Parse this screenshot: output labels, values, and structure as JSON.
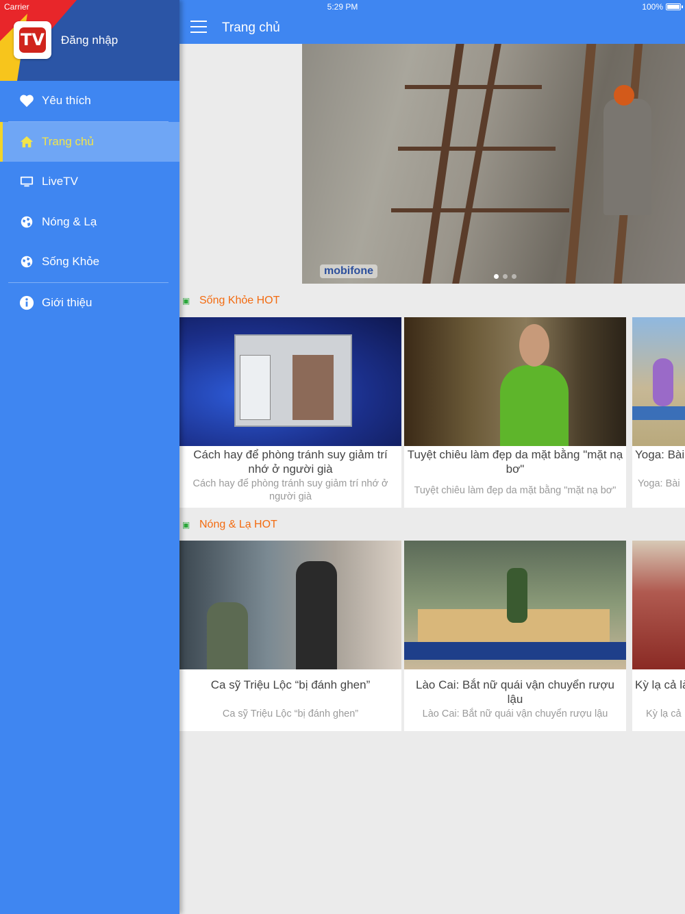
{
  "status_bar": {
    "carrier": "Carrier",
    "time": "5:29 PM",
    "battery": "100%"
  },
  "header": {
    "title": "Trang chủ"
  },
  "hero": {
    "logo_text": "mobifone",
    "slide_count": 3,
    "active_slide": 1
  },
  "sections": [
    {
      "title": "Sống Khỏe HOT",
      "cards": [
        {
          "title": "Cách hay để phòng tránh suy giảm trí nhớ ở người già",
          "desc": "Cách hay để phòng tránh suy giảm trí nhớ ở người già"
        },
        {
          "title": "Tuyệt chiêu làm đẹp da mặt bằng \"mặt nạ bơ\"",
          "desc": "Tuyệt chiêu làm đẹp da mặt bằng \"mặt nạ bơ\""
        },
        {
          "title": "Yoga: Bài",
          "desc": "Yoga: Bài"
        }
      ]
    },
    {
      "title": "Nóng & Lạ HOT",
      "cards": [
        {
          "title": "Ca sỹ Triệu Lộc “bị đánh ghen”",
          "desc": "Ca sỹ Triệu Lộc “bị đánh ghen”"
        },
        {
          "title": "Lào Cai: Bắt nữ quái vận chuyển rượu lậu",
          "desc": "Lào Cai: Bắt nữ quái vận chuyển rượu lậu"
        },
        {
          "title": "Kỳ lạ cả là",
          "desc": "Kỳ lạ cả"
        }
      ]
    }
  ],
  "drawer": {
    "logo_text": "TV",
    "login_label": "Đăng nhập",
    "items": [
      {
        "label": "Yêu thích",
        "icon": "heart-icon"
      },
      {
        "label": "Trang chủ",
        "icon": "home-icon",
        "active": true
      },
      {
        "label": "LiveTV",
        "icon": "monitor-icon"
      },
      {
        "label": "Nóng & Lạ",
        "icon": "globe-icon"
      },
      {
        "label": "Sống Khỏe",
        "icon": "globe-icon"
      },
      {
        "label": "Giới thiệu",
        "icon": "info-icon"
      }
    ]
  },
  "colors": {
    "primary": "#3f86f1",
    "drawer_header": "#2b55a6",
    "accent": "#f36b10",
    "active_nav": "#6fa6f5",
    "active_bar": "#f2d42a"
  }
}
